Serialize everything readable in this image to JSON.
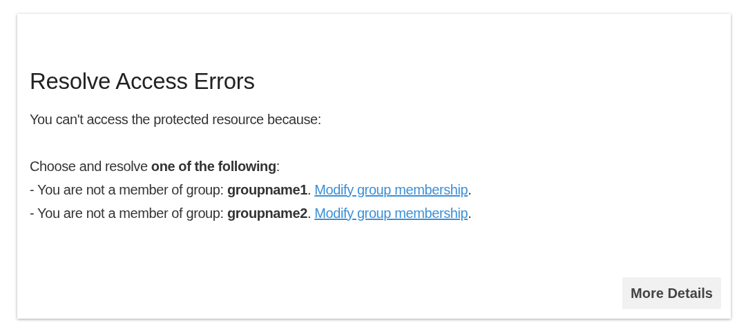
{
  "dialog": {
    "title": "Resolve Access Errors",
    "message": "You can't access the protected resource because:",
    "instruction": "Choose and resolve **one of the following**:",
    "reasons": [
      {
        "text": "- You are not a member of group: **groupname1**.",
        "link": "Modify group membership",
        "suffix": "."
      },
      {
        "text": "- You are not a member of group: **groupname2**.",
        "link": "Modify group membership",
        "suffix": "."
      }
    ],
    "buttons": [
      "More Details"
    ]
  }
}
